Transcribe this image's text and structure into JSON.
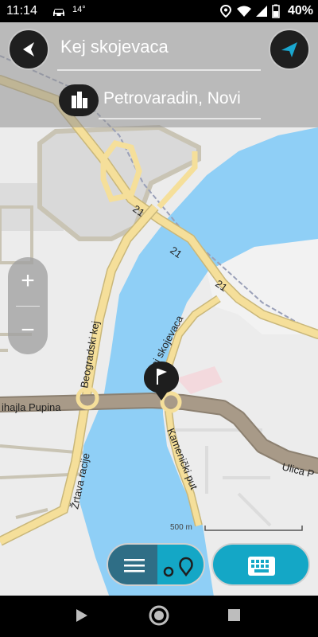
{
  "status_bar": {
    "time": "11:14",
    "temperature": "14°",
    "battery": "40%",
    "icons": [
      "car-icon",
      "location-icon",
      "wifi-icon",
      "signal-icon",
      "battery-icon"
    ]
  },
  "search": {
    "query": "Kej skojevaca",
    "place": "Petrovaradin, Novi"
  },
  "map": {
    "road_labels": {
      "route_21_a": "21",
      "route_21_b": "21",
      "route_21_c": "21",
      "beogradski_kej": "Beogradski kej",
      "kej_skojevaca": "Kej skojevaca",
      "mihajla_pupina": "ihajla Pupina",
      "zrtava_racije": "Žrtava racije",
      "kamenicki_put": "Kamenički put",
      "ulica_p": "Ulica P"
    },
    "scale": "500 m",
    "colors": {
      "water": "#8fcff6",
      "land": "#ececec",
      "main_road": "#f5df9a",
      "route_highlight": "#a89a88"
    }
  },
  "zoom": {
    "in_label": "+",
    "out_label": "−"
  },
  "nav": {
    "back": "back",
    "home": "home",
    "recents": "recents"
  }
}
